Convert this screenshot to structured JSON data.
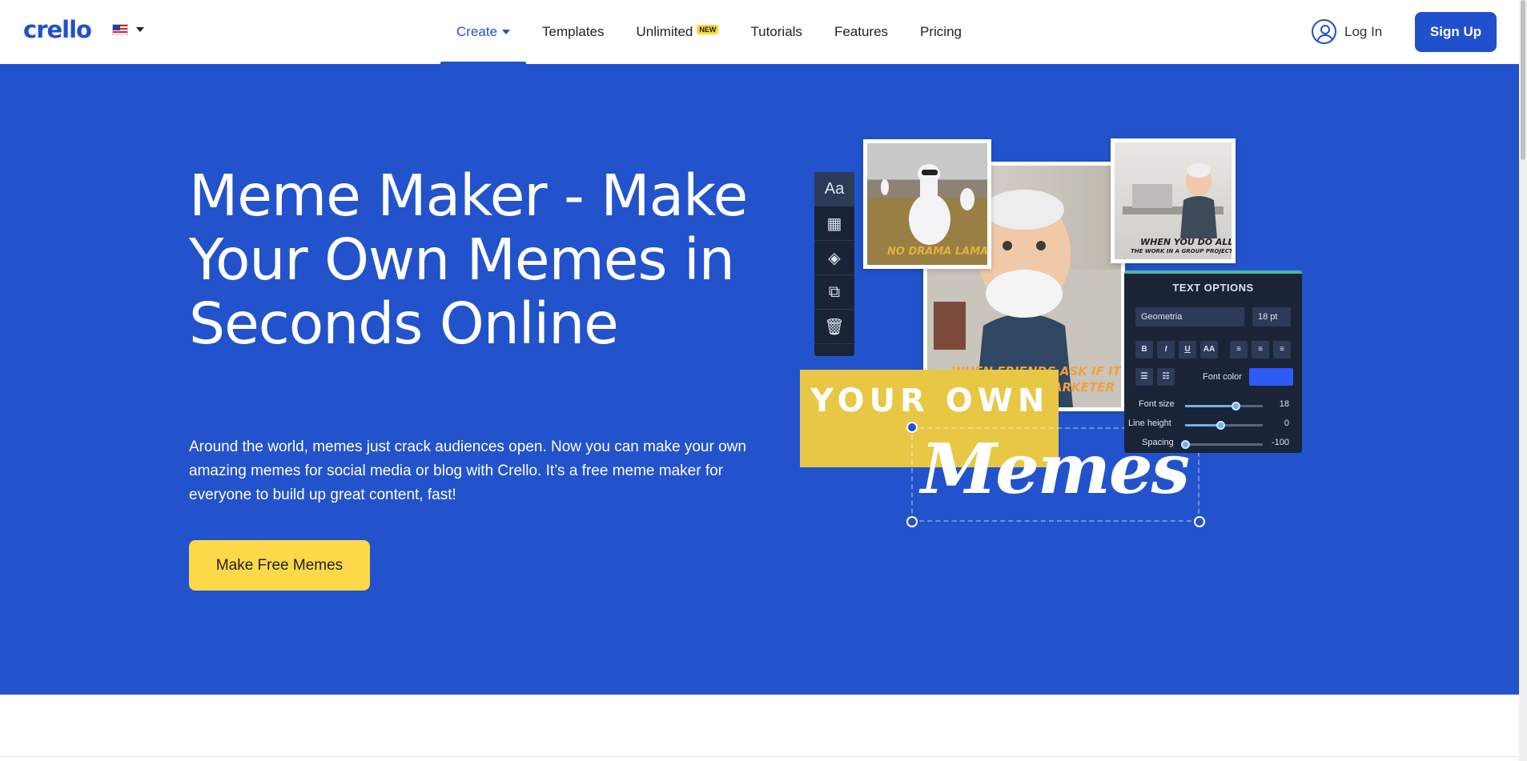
{
  "nav": {
    "logo": "crello",
    "menu": [
      {
        "label": "Create"
      },
      {
        "label": "Templates"
      },
      {
        "label": "Unlimited",
        "badge": "NEW"
      },
      {
        "label": "Tutorials"
      },
      {
        "label": "Features"
      },
      {
        "label": "Pricing"
      }
    ],
    "login_label": "Log In",
    "signup_label": "Sign Up",
    "accent_color": "#2150cc"
  },
  "hero": {
    "title": "Meme Maker - Make Your Own Memes in Seconds Online",
    "lead": "Around the world, memes just crack audiences open. Now you can make your own amazing memes for social media or blog with Crello. It’s a free meme maker for everyone to build up great content, fast!",
    "cta_label": "Make Free Memes",
    "background_color": "#2253cc",
    "cta_color": "#fdd94a"
  },
  "illustration": {
    "llama_caption": "NO DRAMA LAMA",
    "office_caption_1": "WHEN YOU DO ALL",
    "office_caption_2": "THE WORK IN A GROUP PROJECT",
    "man_caption_1": "WHEN FRIENDS ASK IF IT'S HARD",
    "man_caption_2": "TO BE A MARKETER",
    "your_own": "YOUR OWN",
    "memes": "Memes",
    "toolbar_icons": [
      "text-icon",
      "transparency-icon",
      "layers-icon",
      "duplicate-icon",
      "trash-icon"
    ],
    "panel": {
      "title": "TEXT OPTIONS",
      "font": "Geometria",
      "size": "18 pt",
      "formats": [
        "B",
        "I",
        "U",
        "AA"
      ],
      "font_color_label": "Font color",
      "font_color": "#2c5cf5",
      "rows": [
        {
          "label": "Font size",
          "value": "18",
          "level": 0.65
        },
        {
          "label": "Line height",
          "value": "0",
          "level": 0.45
        },
        {
          "label": "Spacing",
          "value": "-100",
          "level": 0.0
        }
      ]
    }
  }
}
